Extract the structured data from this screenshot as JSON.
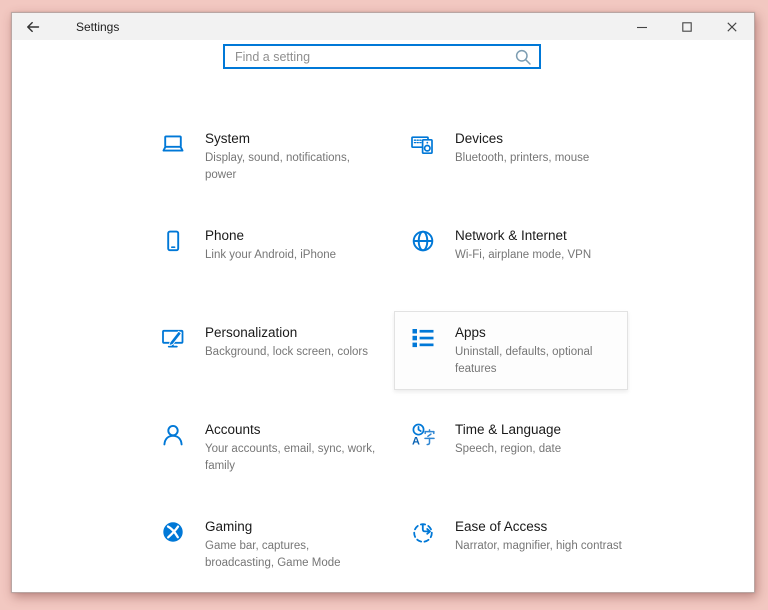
{
  "window": {
    "title": "Settings",
    "controls": {
      "minimize": "minimize-icon",
      "maximize": "maximize-icon",
      "close": "close-icon"
    },
    "back": "back-arrow-icon"
  },
  "search": {
    "placeholder": "Find a setting",
    "icon": "magnifier-icon"
  },
  "colors": {
    "accent": "#0078d7",
    "desktop_background": "#f2c8c1",
    "titlebar_background": "#f2f2f2",
    "search_border": "#0078d7"
  },
  "tiles": [
    {
      "title": "System",
      "subtitle": "Display, sound, notifications, power",
      "icon": "laptop-icon",
      "highlighted": false
    },
    {
      "title": "Devices",
      "subtitle": "Bluetooth, printers, mouse",
      "icon": "keyboard-speaker-icon",
      "highlighted": false
    },
    {
      "title": "Phone",
      "subtitle": "Link your Android, iPhone",
      "icon": "smartphone-icon",
      "highlighted": false
    },
    {
      "title": "Network & Internet",
      "subtitle": "Wi-Fi, airplane mode, VPN",
      "icon": "globe-icon",
      "highlighted": false
    },
    {
      "title": "Personalization",
      "subtitle": "Background, lock screen, colors",
      "icon": "monitor-brush-icon",
      "highlighted": false
    },
    {
      "title": "Apps",
      "subtitle": "Uninstall, defaults, optional features",
      "icon": "app-list-icon",
      "highlighted": true
    },
    {
      "title": "Accounts",
      "subtitle": "Your accounts, email, sync, work, family",
      "icon": "person-icon",
      "highlighted": false
    },
    {
      "title": "Time & Language",
      "subtitle": "Speech, region, date",
      "icon": "clock-language-icon",
      "highlighted": false
    },
    {
      "title": "Gaming",
      "subtitle": "Game bar, captures, broadcasting, Game Mode",
      "icon": "xbox-icon",
      "highlighted": false
    },
    {
      "title": "Ease of Access",
      "subtitle": "Narrator, magnifier, high contrast",
      "icon": "ease-of-access-icon",
      "highlighted": false
    }
  ]
}
